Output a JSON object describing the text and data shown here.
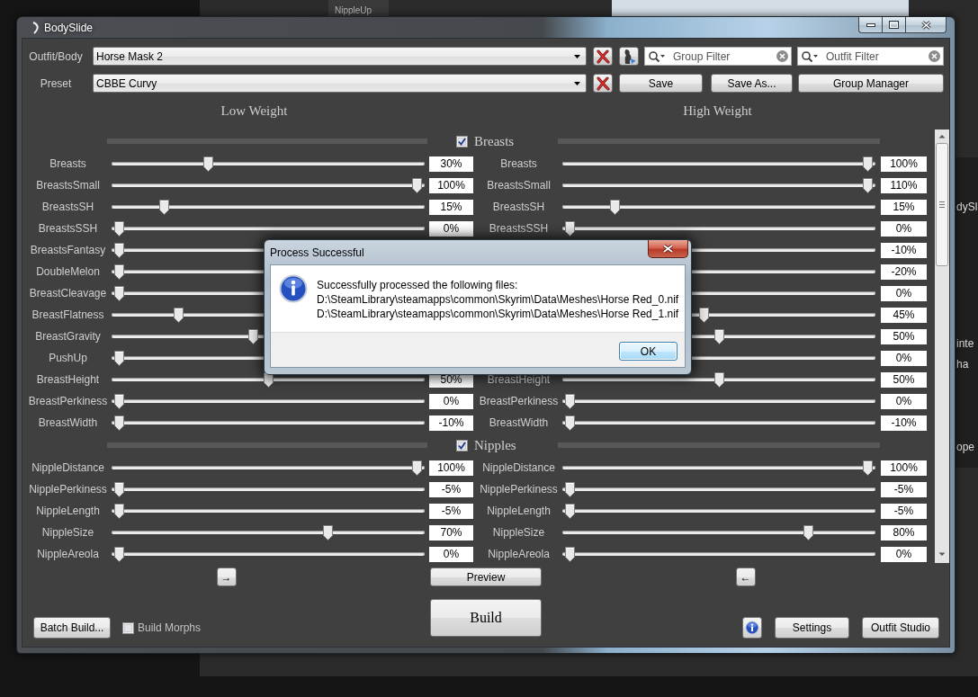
{
  "background": {
    "list_item": "NippleUp",
    "editor_fragments": [
      "dySl",
      "inte",
      "ha",
      "ope"
    ]
  },
  "window": {
    "title": "BodySlide"
  },
  "outfit_body": {
    "label": "Outfit/Body",
    "value": "Horse Mask 2"
  },
  "preset": {
    "label": "Preset",
    "value": "CBBE Curvy"
  },
  "filters": [
    {
      "placeholder": "Group Filter"
    },
    {
      "placeholder": "Outfit Filter"
    }
  ],
  "preset_buttons": [
    "Save",
    "Save As...",
    "Group Manager"
  ],
  "weight_headings": [
    "Low Weight",
    "High Weight"
  ],
  "groups": [
    {
      "name": "Breasts",
      "checked": true,
      "sliders": [
        {
          "low": {
            "label": "Breasts",
            "value": "30%",
            "level": 0.3
          },
          "high": {
            "label": "Breasts",
            "value": "100%",
            "level": 1
          }
        },
        {
          "low": {
            "label": "BreastsSmall",
            "value": "100%",
            "level": 1
          },
          "high": {
            "label": "BreastsSmall",
            "value": "110%",
            "level": 1
          }
        },
        {
          "low": {
            "label": "BreastsSH",
            "value": "15%",
            "level": 0.15
          },
          "high": {
            "label": "BreastsSH",
            "value": "15%",
            "level": 0.15
          }
        },
        {
          "low": {
            "label": "BreastsSSH",
            "value": "0%",
            "level": 0
          },
          "high": {
            "label": "BreastsSSH",
            "value": "0%",
            "level": 0
          }
        },
        {
          "low": {
            "label": "BreastsFantasy",
            "level": 0
          },
          "high": {
            "value": "-10%"
          }
        },
        {
          "low": {
            "label": "DoubleMelon",
            "level": 0
          },
          "high": {
            "value": "-20%"
          }
        },
        {
          "low": {
            "label": "BreastCleavage",
            "level": 0
          },
          "high": {
            "value": "0%"
          }
        },
        {
          "low": {
            "label": "BreastFlatness",
            "level": 0.2
          },
          "high": {
            "value": "45%",
            "level": 0.45
          }
        },
        {
          "low": {
            "label": "BreastGravity",
            "level": 0.45
          },
          "high": {
            "value": "50%",
            "level": 0.5
          }
        },
        {
          "low": {
            "label": "PushUp",
            "level": 0
          },
          "high": {
            "value": "0%"
          }
        },
        {
          "low": {
            "label": "BreastHeight",
            "value": "50%",
            "level": 0.5
          },
          "high": {
            "label": "BreastHeight",
            "value": "50%",
            "level": 0.5
          }
        },
        {
          "low": {
            "label": "BreastPerkiness",
            "value": "0%",
            "level": 0
          },
          "high": {
            "label": "BreastPerkiness",
            "value": "0%",
            "level": 0
          }
        },
        {
          "low": {
            "label": "BreastWidth",
            "value": "-10%",
            "level": 0
          },
          "high": {
            "label": "BreastWidth",
            "value": "-10%",
            "level": 0
          }
        }
      ]
    },
    {
      "name": "Nipples",
      "checked": true,
      "sliders": [
        {
          "low": {
            "label": "NippleDistance",
            "value": "100%",
            "level": 1
          },
          "high": {
            "label": "NippleDistance",
            "value": "100%",
            "level": 1
          }
        },
        {
          "low": {
            "label": "NipplePerkiness",
            "value": "-5%",
            "level": 0
          },
          "high": {
            "label": "NipplePerkiness",
            "value": "-5%",
            "level": 0
          }
        },
        {
          "low": {
            "label": "NippleLength",
            "value": "-5%",
            "level": 0
          },
          "high": {
            "label": "NippleLength",
            "value": "-5%",
            "level": 0
          }
        },
        {
          "low": {
            "label": "NippleSize",
            "value": "70%",
            "level": 0.7
          },
          "high": {
            "label": "NippleSize",
            "value": "80%",
            "level": 0.8
          }
        },
        {
          "low": {
            "label": "NippleAreola",
            "value": "0%",
            "level": 0
          },
          "high": {
            "label": "NippleAreola",
            "value": "0%",
            "level": 0
          }
        }
      ]
    }
  ],
  "copy_buttons": [
    "→",
    "←"
  ],
  "preview_button": "Preview",
  "build_button": "Build",
  "batch_build_button": "Batch Build...",
  "build_morphs": {
    "label": "Build Morphs",
    "checked": false
  },
  "bottom_buttons": [
    "Settings",
    "Outfit Studio"
  ],
  "dialog": {
    "title": "Process Successful",
    "lines": [
      "Successfully processed the following files:",
      "D:\\SteamLibrary\\steamapps\\common\\Skyrim\\Data\\Meshes\\Horse Red_0.nif",
      "D:\\SteamLibrary\\steamapps\\common\\Skyrim\\Data\\Meshes\\Horse Red_1.nif"
    ],
    "button": "OK"
  }
}
